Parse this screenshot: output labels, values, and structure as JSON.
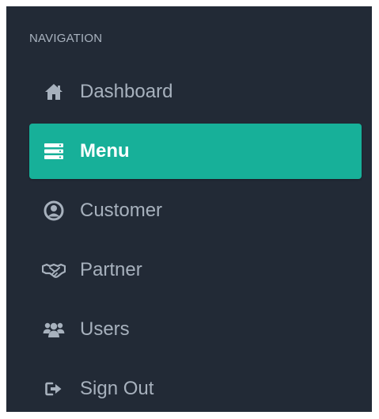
{
  "sidebar": {
    "heading": "NAVIGATION",
    "colors": {
      "background": "#222a36",
      "active": "#17b099",
      "text": "#a7b1bd",
      "active_text": "#ffffff"
    },
    "items": [
      {
        "label": "Dashboard",
        "icon": "home-icon",
        "active": false
      },
      {
        "label": "Menu",
        "icon": "server-menu-icon",
        "active": true
      },
      {
        "label": "Customer",
        "icon": "user-circle-icon",
        "active": false
      },
      {
        "label": "Partner",
        "icon": "handshake-icon",
        "active": false
      },
      {
        "label": "Users",
        "icon": "users-icon",
        "active": false
      },
      {
        "label": "Sign Out",
        "icon": "sign-out-icon",
        "active": false
      }
    ]
  }
}
